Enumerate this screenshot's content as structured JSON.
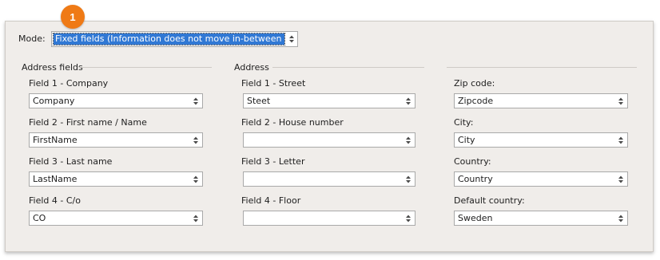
{
  "badge": "1",
  "mode": {
    "label": "Mode:",
    "value": "Fixed fields (Information does not move in-between fields)"
  },
  "address_fields": {
    "heading": "Address fields",
    "fields": [
      {
        "label": "Field 1 - Company",
        "value": "Company"
      },
      {
        "label": "Field 2 - First name / Name",
        "value": "FirstName"
      },
      {
        "label": "Field 3 - Last name",
        "value": "LastName"
      },
      {
        "label": "Field 4 - C/o",
        "value": "CO"
      }
    ]
  },
  "address": {
    "heading": "Address",
    "fields": [
      {
        "label": "Field 1 - Street",
        "value": "Steet"
      },
      {
        "label": "Field 2 - House number",
        "value": ""
      },
      {
        "label": "Field 3 - Letter",
        "value": ""
      },
      {
        "label": "Field 4 - Floor",
        "value": ""
      }
    ]
  },
  "location": {
    "fields": [
      {
        "label": "Zip code:",
        "value": "Zipcode"
      },
      {
        "label": "City:",
        "value": "City"
      },
      {
        "label": "Country:",
        "value": "Country"
      },
      {
        "label": "Default country:",
        "value": "Sweden"
      }
    ]
  }
}
